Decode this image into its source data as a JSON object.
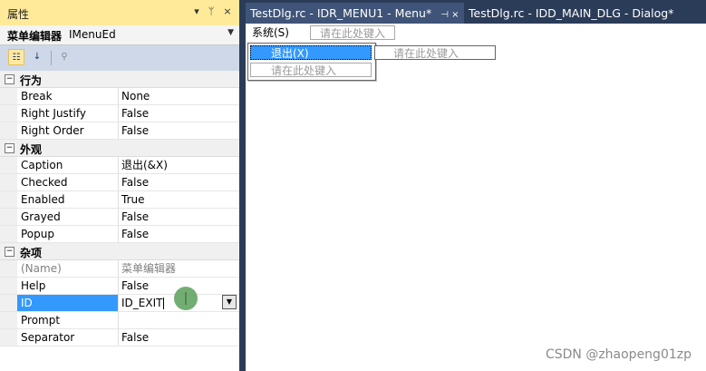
{
  "panel": {
    "title": "属性",
    "title_buttons": [
      "▾",
      "ᛘ",
      "×"
    ],
    "object_name": "菜单编辑器",
    "object_type": "IMenuEd",
    "toolbar_icons": [
      "categorized-icon",
      "alphabetical-icon",
      "property-pages-icon"
    ]
  },
  "categories": [
    {
      "name": "行为",
      "props": [
        {
          "key": "Break",
          "value": "None"
        },
        {
          "key": "Right Justify",
          "value": "False"
        },
        {
          "key": "Right Order",
          "value": "False"
        }
      ]
    },
    {
      "name": "外观",
      "props": [
        {
          "key": "Caption",
          "value": "退出(&X)"
        },
        {
          "key": "Checked",
          "value": "False"
        },
        {
          "key": "Enabled",
          "value": "True"
        },
        {
          "key": "Grayed",
          "value": "False"
        },
        {
          "key": "Popup",
          "value": "False"
        }
      ]
    },
    {
      "name": "杂项",
      "props": [
        {
          "key": "(Name)",
          "value": "菜单编辑器"
        },
        {
          "key": "Help",
          "value": "False"
        },
        {
          "key": "ID",
          "value": "ID_EXIT"
        },
        {
          "key": "Prompt",
          "value": ""
        },
        {
          "key": "Separator",
          "value": "False"
        }
      ]
    }
  ],
  "tabs": [
    {
      "label": "TestDlg.rc - IDR_MENU1 - Menu*",
      "pin": "⊣ ×"
    },
    {
      "label": "TestDlg.rc - IDD_MAIN_DLG - Dialog*"
    }
  ],
  "menu": {
    "top_item": "系统(S)",
    "type_here": "请在此处键入",
    "popup_selected": "退出(X)",
    "popup_type_here": "请在此处键入",
    "submenu_type_here": "请在此处键入"
  },
  "watermark": "CSDN @zhaopeng01zp",
  "colors": {
    "accent": "#3399ff",
    "title_bg": "#ffea9a",
    "frame": "#2b3c59"
  }
}
